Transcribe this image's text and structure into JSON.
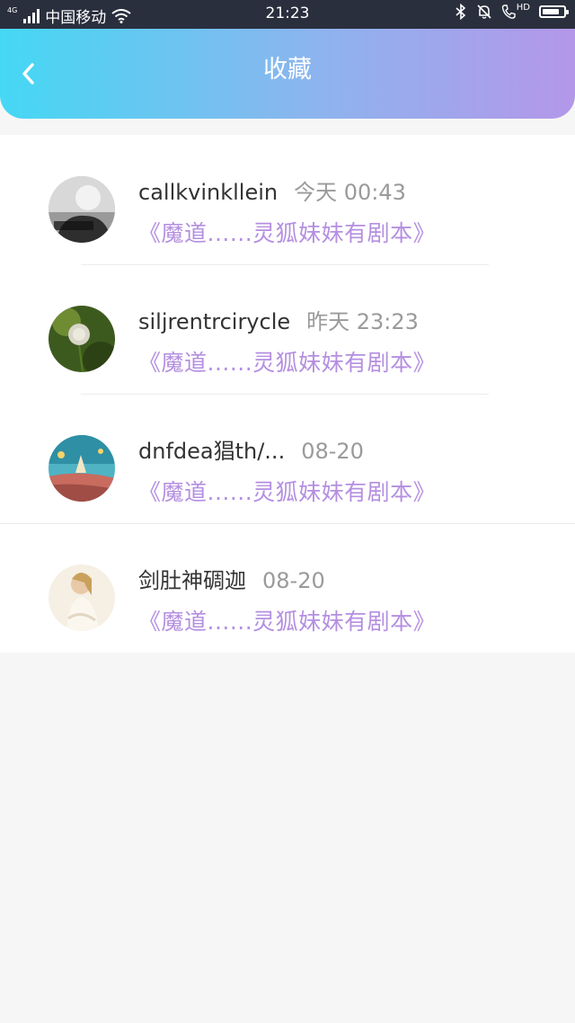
{
  "status_bar": {
    "network_tag": "4G",
    "carrier": "中国移动",
    "time": "21:23",
    "hd_label": "HD",
    "battery_level": 0.8
  },
  "header": {
    "title": "收藏",
    "back_icon": "chevron-left-icon"
  },
  "favorites": [
    {
      "name": "callkvinkllein",
      "time": "今天 00:43",
      "link": "《魔道......灵狐妹妹有剧本》"
    },
    {
      "name": "siljrentrcirycle",
      "time": "昨天 23:23",
      "link": "《魔道......灵狐妹妹有剧本》"
    },
    {
      "name": "dnfdea猖th/...",
      "time": "08-20",
      "link": "《魔道......灵狐妹妹有剧本》"
    },
    {
      "name": "剑肚神碉迦",
      "time": "08-20",
      "link": "《魔道......灵狐妹妹有剧本》"
    }
  ],
  "colors": {
    "header_gradient_start": "#45d8f4",
    "header_gradient_end": "#b497e9",
    "link": "#b48fe0"
  }
}
